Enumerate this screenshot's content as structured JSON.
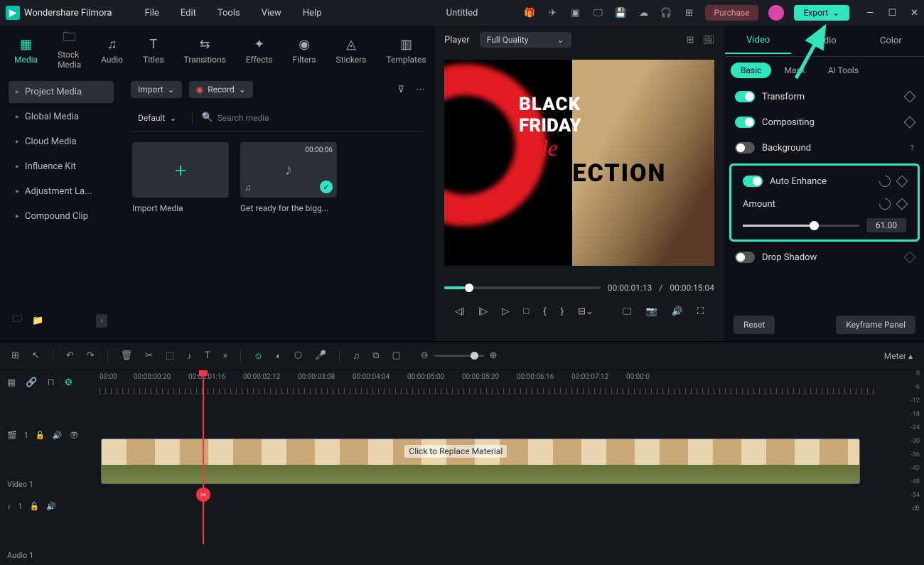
{
  "app": {
    "name": "Wondershare Filmora",
    "title": "Untitled"
  },
  "menu": [
    "File",
    "Edit",
    "Tools",
    "View",
    "Help"
  ],
  "titlebar": {
    "purchase": "Purchase",
    "export": "Export"
  },
  "asset_tabs": [
    {
      "label": "Media",
      "active": true
    },
    {
      "label": "Stock Media"
    },
    {
      "label": "Audio"
    },
    {
      "label": "Titles"
    },
    {
      "label": "Transitions"
    },
    {
      "label": "Effects"
    },
    {
      "label": "Filters"
    },
    {
      "label": "Stickers"
    },
    {
      "label": "Templates"
    }
  ],
  "categories": [
    {
      "label": "Project Media",
      "active": true
    },
    {
      "label": "Global Media"
    },
    {
      "label": "Cloud Media"
    },
    {
      "label": "Influence Kit"
    },
    {
      "label": "Adjustment La..."
    },
    {
      "label": "Compound Clip"
    }
  ],
  "media_top": {
    "import": "Import",
    "record": "Record",
    "default": "Default",
    "search_ph": "Search media"
  },
  "media_items": [
    {
      "label": "Import Media",
      "plus": true
    },
    {
      "label": "Get ready for the bigg...",
      "duration": "00:00:06",
      "checked": true
    }
  ],
  "player": {
    "label": "Player",
    "quality": "Full Quality",
    "current": "00:00:01:13",
    "total": "00:00:15:04",
    "sep": "/"
  },
  "preview_text": {
    "l1": "BLACK",
    "l2": "FRIDAY",
    "l3": "Sale",
    "l4": "LECTION"
  },
  "inspector": {
    "tabs": [
      "Video",
      "Audio",
      "Color"
    ],
    "subtabs": [
      "Basic",
      "Mask",
      "AI Tools"
    ],
    "props": {
      "transform": "Transform",
      "compositing": "Compositing",
      "background": "Background",
      "auto_enhance": "Auto Enhance",
      "amount": "Amount",
      "drop_shadow": "Drop Shadow"
    },
    "amount_value": "61.00",
    "footer": {
      "reset": "Reset",
      "keyframe": "Keyframe Panel"
    }
  },
  "timeline": {
    "timestamps": [
      "00:00",
      "00:00:00:20",
      "00:00:01:16",
      "00:00:02:12",
      "00:00:03:08",
      "00:00:04:04",
      "00:00:05:00",
      "00:00:05:20",
      "00:00:06:16",
      "00:00:07:12",
      "00:00:0"
    ],
    "tracks": {
      "video": "Video 1",
      "audio": "Audio 1",
      "v_num": "1",
      "a_num": "1"
    },
    "replace": "Click to Replace Material",
    "meter": "Meter",
    "meter_scale": [
      "0",
      "-6",
      "-12",
      "-18",
      "-24",
      "-30",
      "-36",
      "-42",
      "-48",
      "-54",
      "dB"
    ]
  }
}
